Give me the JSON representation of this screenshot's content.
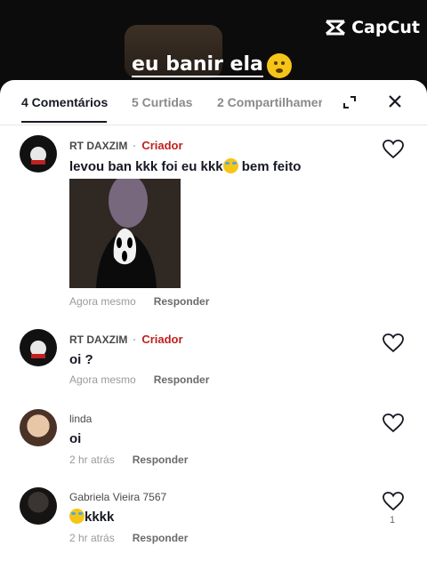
{
  "video": {
    "brand": "CapCut",
    "caption": "eu banir ela",
    "caption_emoji": "shushing-face"
  },
  "tabs": [
    {
      "label": "4 Comentários",
      "active": true
    },
    {
      "label": "5 Curtidas",
      "active": false
    },
    {
      "label": "2 Compartilhamer",
      "active": false
    }
  ],
  "comments": [
    {
      "user": "RT DAXZIM",
      "badge": "Criador",
      "text": "levou ban kkk foi eu kkk",
      "emoji": "laughing-tears",
      "text_suffix": " bem feito",
      "has_image": true,
      "time": "Agora mesmo",
      "reply": "Responder",
      "likes": ""
    },
    {
      "user": "RT DAXZIM",
      "badge": "Criador",
      "text": "oi ?",
      "time": "Agora mesmo",
      "reply": "Responder",
      "likes": ""
    },
    {
      "user": "linda",
      "badge": "",
      "text": "oi",
      "time": "2 hr atrás",
      "reply": "Responder",
      "likes": ""
    },
    {
      "user": "Gabriela Vieira 7567",
      "badge": "",
      "text": "kkkk",
      "emoji_prefix": "laughing-tears",
      "time": "2 hr atrás",
      "reply": "Responder",
      "likes": "1"
    }
  ],
  "colors": {
    "creator": "#c0211f",
    "text": "#161823",
    "muted": "#9a9a9a"
  }
}
